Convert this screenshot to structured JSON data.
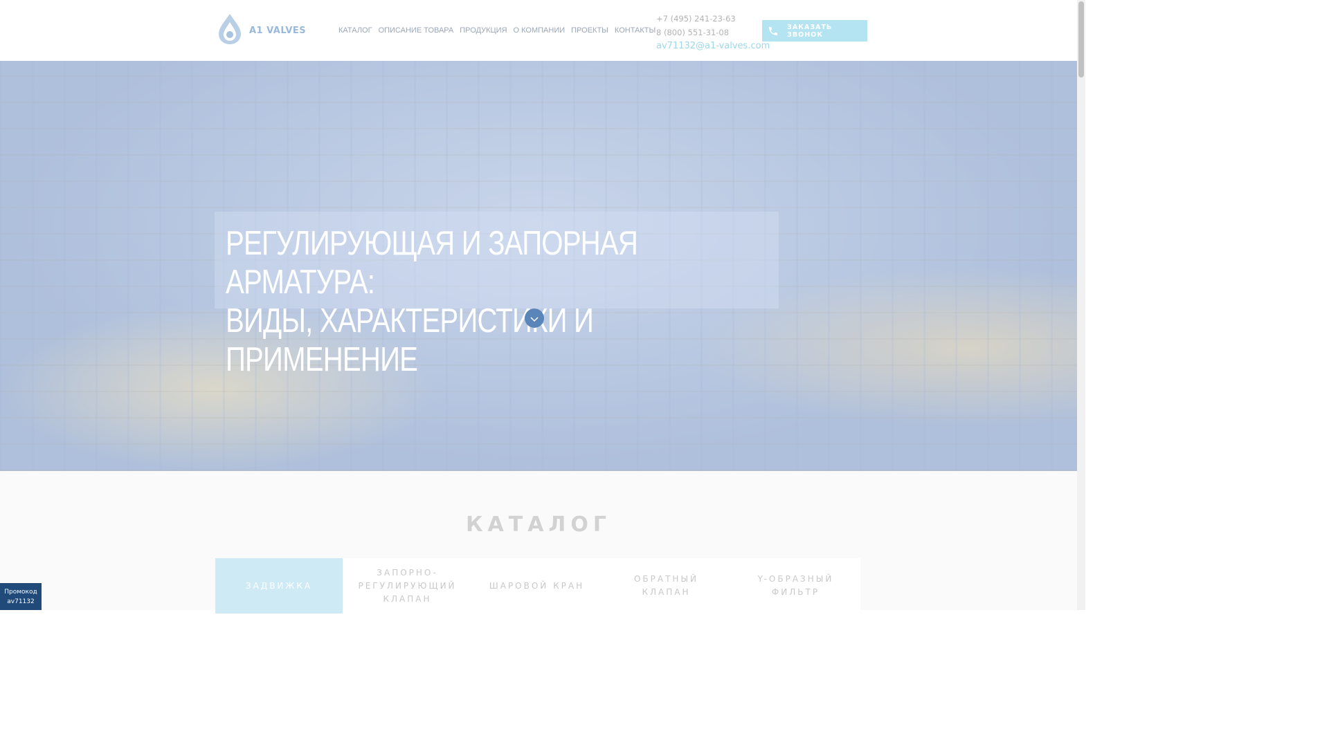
{
  "header": {
    "logo_text": "A1 VALVES",
    "nav": [
      "КАТАЛОГ",
      "ОПИСАНИЕ ТОВАРА",
      "ПРОДУКЦИЯ",
      "О КОМПАНИИ",
      "ПРОЕКТЫ",
      "КОНТАКТЫ"
    ],
    "phone1": "+7 (495) 241-23-63",
    "phone2": "8 (800) 551-31-08",
    "email": "av71132@a1-valves.com",
    "callback_label": "ЗАКАЗАТЬ ЗВОНОК"
  },
  "hero": {
    "title_line1": "РЕГУЛИРУЮЩАЯ И ЗАПОРНАЯ АРМАТУРА:",
    "title_line2": "ВИДЫ, ХАРАКТЕРИСТИКИ И ПРИМЕНЕНИЕ"
  },
  "catalog": {
    "title": "КАТАЛОГ",
    "tabs": [
      "ЗАДВИЖКА",
      "ЗАПОРНО-РЕГУЛИРУЮЩИЙ КЛАПАН",
      "ШАРОВОЙ КРАН",
      "ОБРАТНЫЙ КЛАПАН",
      "Y-ОБРАЗНЫЙ ФИЛЬТР"
    ],
    "active_tab": 0
  },
  "promo": {
    "label": "Промокод",
    "code": "av71132"
  },
  "colors": {
    "accent": "#b4e4f2",
    "email": "#9ed7ea",
    "promo_bg": "#1f4a7a",
    "scroll_button": "#5a85b8"
  },
  "icons": [
    "droplet-logo-icon",
    "phone-icon",
    "chevron-down-icon"
  ]
}
